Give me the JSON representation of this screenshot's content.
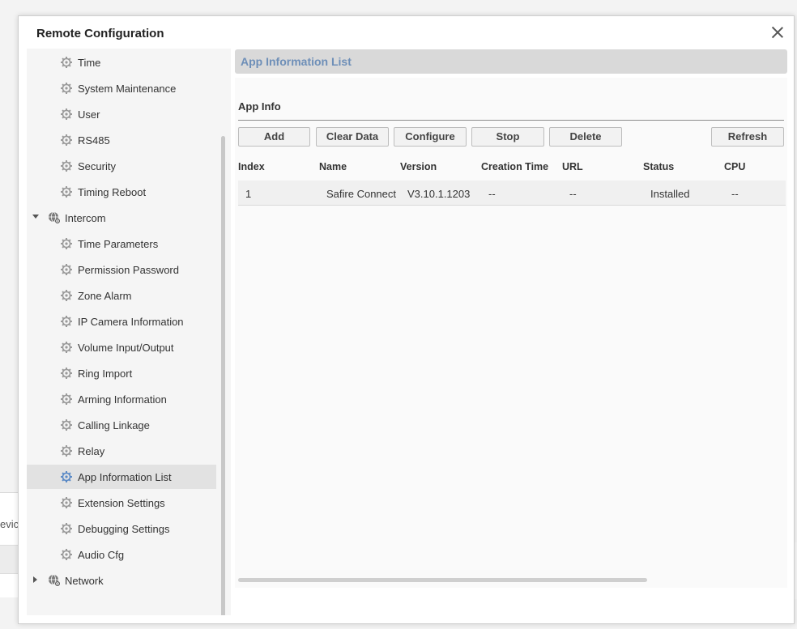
{
  "background": {
    "partial_text": "evic"
  },
  "dialog": {
    "title": "Remote Configuration"
  },
  "sidebar": {
    "items": [
      {
        "label": "Time",
        "type": "leaf"
      },
      {
        "label": "System Maintenance",
        "type": "leaf"
      },
      {
        "label": "User",
        "type": "leaf"
      },
      {
        "label": "RS485",
        "type": "leaf"
      },
      {
        "label": "Security",
        "type": "leaf"
      },
      {
        "label": "Timing Reboot",
        "type": "leaf"
      },
      {
        "label": "Intercom",
        "type": "group",
        "expanded": true
      },
      {
        "label": "Time Parameters",
        "type": "leaf"
      },
      {
        "label": "Permission Password",
        "type": "leaf"
      },
      {
        "label": "Zone Alarm",
        "type": "leaf"
      },
      {
        "label": "IP Camera Information",
        "type": "leaf"
      },
      {
        "label": "Volume Input/Output",
        "type": "leaf"
      },
      {
        "label": "Ring Import",
        "type": "leaf"
      },
      {
        "label": "Arming Information",
        "type": "leaf"
      },
      {
        "label": "Calling Linkage",
        "type": "leaf"
      },
      {
        "label": "Relay",
        "type": "leaf"
      },
      {
        "label": "App Information List",
        "type": "leaf",
        "selected": true
      },
      {
        "label": "Extension Settings",
        "type": "leaf"
      },
      {
        "label": "Debugging Settings",
        "type": "leaf"
      },
      {
        "label": "Audio Cfg",
        "type": "leaf"
      },
      {
        "label": "Network",
        "type": "group",
        "expanded": false
      }
    ]
  },
  "main": {
    "section_title": "App Information List",
    "subheading": "App Info",
    "buttons": {
      "add": "Add",
      "clear_data": "Clear Data",
      "configure": "Configure",
      "stop": "Stop",
      "delete": "Delete",
      "refresh": "Refresh"
    },
    "table": {
      "columns": [
        "Index",
        "Name",
        "Version",
        "Creation Time",
        "URL",
        "Status",
        "CPU"
      ],
      "rows": [
        [
          "1",
          "Safire Connect",
          "V3.10.1.1203",
          "--",
          "--",
          "Installed",
          "--"
        ]
      ]
    }
  },
  "colors": {
    "section_title": "#6e8fb8",
    "selected_item_bg": "#e2e2e2",
    "gear_icon": "#9a9a9a",
    "gear_icon_selected": "#5b8ac6"
  },
  "icons": {
    "leaf": "gear-icon",
    "group": "globe-gear-icon",
    "close": "close-icon"
  }
}
